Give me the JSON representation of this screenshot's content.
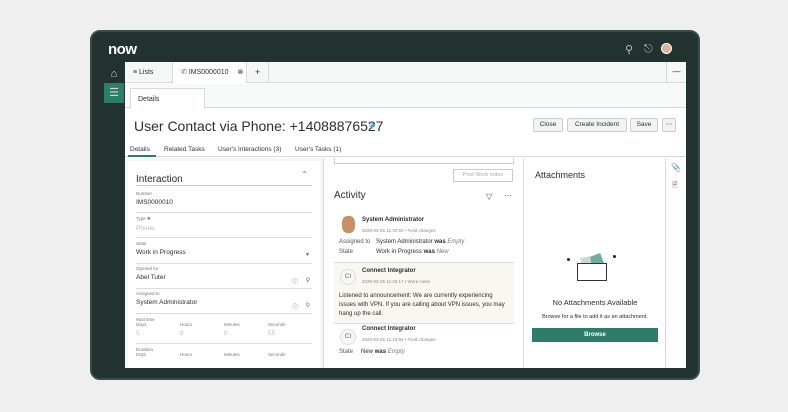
{
  "header": {
    "logo": "now",
    "icons": [
      "search-icon",
      "bell-icon",
      "avatar"
    ]
  },
  "tabs": [
    {
      "label": "Lists",
      "icon": "list-icon"
    },
    {
      "label": "IMS0000010",
      "icon": "phone-icon"
    }
  ],
  "tab_add": "+",
  "details_tab": "Details",
  "record": {
    "title": "User Contact via Phone: +14088876527"
  },
  "buttons": {
    "close": "Close",
    "create_incident": "Create Incident",
    "save": "Save",
    "more": "⋯"
  },
  "subtabs": [
    "Details",
    "Related Tasks",
    "User's Interactions (3)",
    "User's Tasks (1)"
  ],
  "form": {
    "section": "Interaction",
    "number_label": "Number",
    "number": "IMS0000010",
    "type_label": "Type ✱",
    "type": "Phone",
    "state_label": "State",
    "state": "Work in Progress",
    "opened_for_label": "Opened for",
    "opened_for": "Abel Tuter",
    "assigned_to_label": "Assigned to",
    "assigned_to": "System Administrator",
    "wait_time_label": "Wait time",
    "units": [
      "Days",
      "Hours",
      "Minutes",
      "Seconds"
    ],
    "wait_values": [
      "5",
      "0",
      "0",
      "55"
    ],
    "duration_label": "Duration"
  },
  "activity": {
    "post_button": "Post Work notes",
    "title": "Activity",
    "entries": [
      {
        "author": "System Administrator",
        "meta": "2020-03-25 11:20:50 • Field changes",
        "changes": [
          {
            "field": "Assigned to",
            "value": "System Administrator",
            "was": "was",
            "old": "Empty"
          },
          {
            "field": "State",
            "value": "Work in Progress",
            "was": "was",
            "old": "New"
          }
        ]
      },
      {
        "author": "Connect Integrator",
        "initials": "CI",
        "meta": "2020-03-25 11:20:17 • Work notes",
        "text": "Listened to announcement: We are currently experiencing issues with VPN. If you are calling about VPN issues, you may hang up the call."
      },
      {
        "author": "Connect Integrator",
        "initials": "CI",
        "meta": "2020-03-25 11:19:55 • Field changes",
        "changes": [
          {
            "field": "State",
            "value": "New",
            "was": "was",
            "old": "Empty"
          }
        ]
      }
    ]
  },
  "attachments": {
    "title": "Attachments",
    "empty_title": "No Attachments Available",
    "empty_text": "Browse for a file to add it as an attachment.",
    "browse": "Browse"
  },
  "colors": {
    "frame": "#22322f",
    "accent": "#2e7d6b"
  }
}
